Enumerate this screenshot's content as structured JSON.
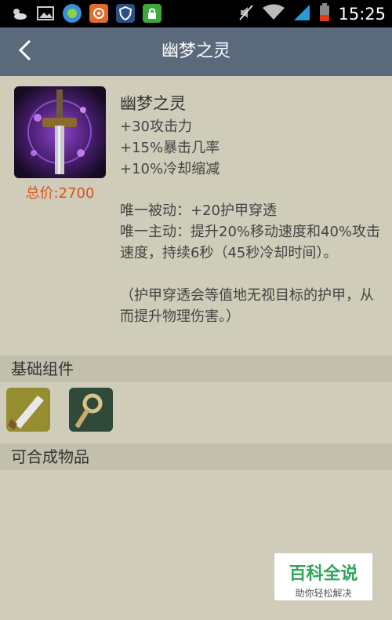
{
  "status_bar": {
    "time": "15:25",
    "left_icons": [
      "weather-icon",
      "image-icon",
      "browser-icon",
      "app-icon",
      "shield-icon",
      "lock-app-icon"
    ],
    "right_icons": [
      "mute-icon",
      "wifi-icon",
      "signal-icon",
      "battery-icon"
    ]
  },
  "header": {
    "title": "幽梦之灵"
  },
  "item": {
    "name": "幽梦之灵",
    "price": "总价:2700",
    "stats": [
      "+30攻击力",
      "+15%暴击几率",
      "+10%冷却缩减"
    ],
    "desc": [
      "唯一被动：+20护甲穿透",
      "唯一主动：提升20%移动速度和40%攻击速度，持续6秒（45秒冷却时间）。",
      "（护甲穿透会等值地无视目标的护甲，从而提升物理伤害。）"
    ]
  },
  "sections": {
    "components": "基础组件",
    "builds_into": "可合成物品"
  },
  "watermark": {
    "title": "百科全说",
    "subtitle": "助你轻松解决"
  },
  "colors": {
    "background": "#cfccb9",
    "header": "#5a6a7c",
    "price": "#d9541a",
    "section": "#c2bfac"
  }
}
